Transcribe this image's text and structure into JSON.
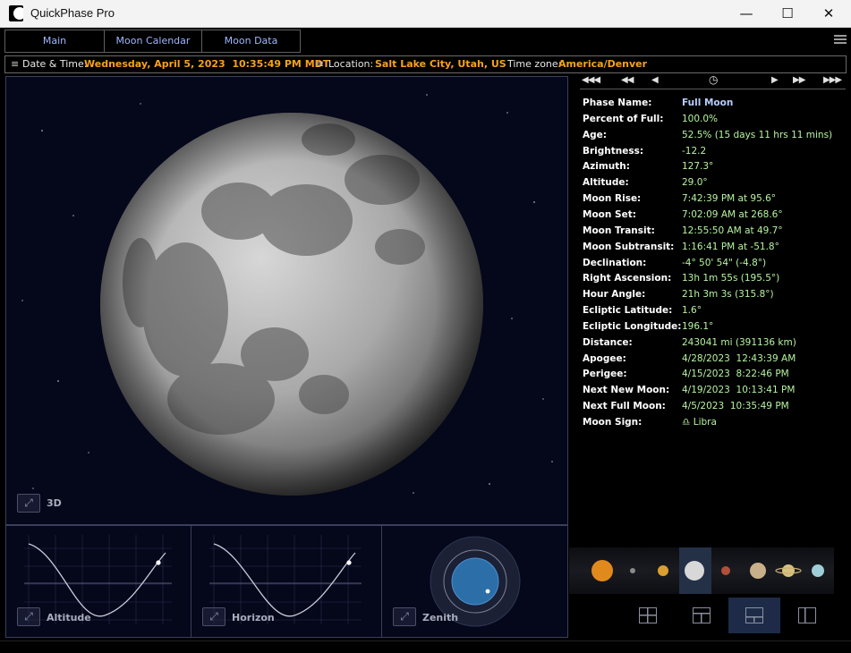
{
  "window": {
    "title": "QuickPhase Pro",
    "minimize": "—",
    "maximize": "☐",
    "close": "✕"
  },
  "tabs": [
    {
      "label": "Main"
    },
    {
      "label": "Moon Calendar"
    },
    {
      "label": "Moon Data"
    }
  ],
  "info_bar": {
    "menu_glyph": "≡",
    "datetime_label": "Date & Time:",
    "datetime_value": "Wednesday, April 5, 2023  10:35:49 PM MDT",
    "location_label": "Location:",
    "location_value": "Salt Lake City, Utah, US",
    "timezone_label": "Time zone:",
    "timezone_value": "America/Denver"
  },
  "moon_view": {
    "mode_label": "3D",
    "mini_panels": [
      {
        "label": "Altitude"
      },
      {
        "label": "Horizon"
      },
      {
        "label": "Zenith"
      }
    ]
  },
  "nav": {
    "back_month": "◀◀◀",
    "back_day": "◀◀",
    "back_step": "◀",
    "now": "◷",
    "fwd_step": "▶",
    "fwd_day": "▶▶",
    "fwd_month": "▶▶▶"
  },
  "moon_data": [
    {
      "key": "Phase Name:",
      "value": "Full Moon"
    },
    {
      "key": "Percent of Full:",
      "value": "100.0%"
    },
    {
      "key": "Age:",
      "value": "52.5% (15 days 11 hrs 11 mins)"
    },
    {
      "key": "Brightness:",
      "value": "-12.2"
    },
    {
      "key": "Azimuth:",
      "value": "127.3°"
    },
    {
      "key": "Altitude:",
      "value": "29.0°"
    },
    {
      "key": "Moon Rise:",
      "value": "7:42:39 PM at 95.6°"
    },
    {
      "key": "Moon Set:",
      "value": "7:02:09 AM at 268.6°"
    },
    {
      "key": "Moon Transit:",
      "value": "12:55:50 AM at 49.7°"
    },
    {
      "key": "Moon Subtransit:",
      "value": "1:16:41 PM at -51.8°"
    },
    {
      "key": "Declination:",
      "value": "-4° 50' 54\" (-4.8°)"
    },
    {
      "key": "Right Ascension:",
      "value": "13h 1m 55s (195.5°)"
    },
    {
      "key": "Hour Angle:",
      "value": "21h 3m 3s (315.8°)"
    },
    {
      "key": "Ecliptic Latitude:",
      "value": "1.6°"
    },
    {
      "key": "Ecliptic Longitude:",
      "value": "196.1°"
    },
    {
      "key": "Distance:",
      "value": "243041 mi (391136 km)"
    },
    {
      "key": "Apogee:",
      "value": "4/28/2023  12:43:39 AM"
    },
    {
      "key": "Perigee:",
      "value": "4/15/2023  8:22:46 PM"
    },
    {
      "key": "Next New Moon:",
      "value": "4/19/2023  10:13:41 PM"
    },
    {
      "key": "Next Full Moon:",
      "value": "4/5/2023  10:35:49 PM"
    },
    {
      "key": "Moon Sign:",
      "value": "♎ Libra"
    }
  ],
  "planets": [
    {
      "name": "sun",
      "color": "#e08a1e"
    },
    {
      "name": "mercury",
      "color": "#8a8a8a"
    },
    {
      "name": "venus",
      "color": "#d9a030"
    },
    {
      "name": "moon",
      "color": "#d8d8d8"
    },
    {
      "name": "mars",
      "color": "#b0503a"
    },
    {
      "name": "jupiter",
      "color": "#c8b08a"
    },
    {
      "name": "saturn",
      "color": "#d8c080"
    },
    {
      "name": "uranus",
      "color": "#9ecfd8"
    }
  ],
  "layout_buttons": [
    {
      "name": "quad"
    },
    {
      "name": "top-split"
    },
    {
      "name": "bottom-split"
    },
    {
      "name": "side-split"
    }
  ],
  "colors": {
    "accent_orange": "#f7a21a",
    "tab_text": "#9fb6ff",
    "value_green": "#b6f3a0",
    "phase_blue": "#b6cdfc"
  }
}
